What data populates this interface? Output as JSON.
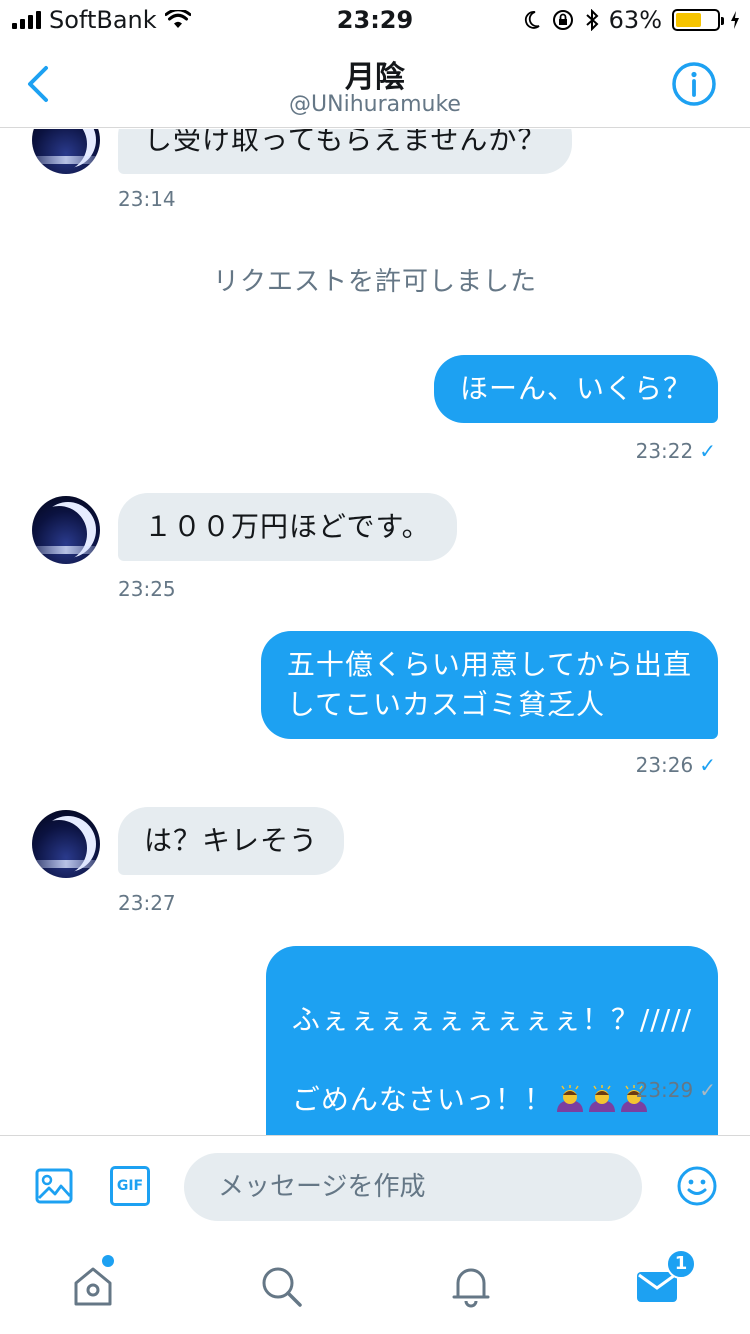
{
  "status_bar": {
    "carrier": "SoftBank",
    "time": "23:29",
    "battery_percent": "63%",
    "battery_level": 0.63,
    "battery_color": "#f6c400",
    "icons": [
      "signal-icon",
      "wifi-icon",
      "moon-icon",
      "rotation-lock-icon",
      "bluetooth-icon",
      "battery-icon",
      "charging-icon"
    ]
  },
  "header": {
    "title": "月陰",
    "handle": "@UNihuramuke",
    "icons": [
      "back-chevron-icon",
      "info-icon"
    ]
  },
  "colors": {
    "accent": "#1da1f2",
    "incoming_bubble": "#e6ecf0",
    "muted_text": "#657786"
  },
  "chat": {
    "messages": [
      {
        "kind": "incoming",
        "text": "し受け取ってもらえませんか？",
        "time": "23:14"
      },
      {
        "kind": "system",
        "text": "リクエストを許可しました"
      },
      {
        "kind": "outgoing",
        "text": "ほーん、いくら？",
        "time": "23:22",
        "read": true
      },
      {
        "kind": "incoming",
        "text": "１００万円ほどです。",
        "time": "23:25"
      },
      {
        "kind": "outgoing",
        "text": "五十億くらい用意してから出直\nしてこいカスゴミ貧乏人",
        "time": "23:26",
        "read": true
      },
      {
        "kind": "incoming",
        "text": "は？キレそう",
        "time": "23:27"
      },
      {
        "kind": "outgoing",
        "line1": "ふぇぇぇぇぇぇぇぇぇ！？/////",
        "line2": "ごめんなさいっ！！",
        "emoji": [
          "bowing-woman-emoji",
          "bowing-woman-emoji",
          "bowing-woman-emoji"
        ],
        "time": "23:29",
        "read": false
      }
    ]
  },
  "composer": {
    "placeholder": "メッセージを作成",
    "gif_label": "GIF",
    "icons": [
      "image-icon",
      "gif-icon",
      "emoji-icon"
    ]
  },
  "tabbar": {
    "tabs": [
      "home",
      "search",
      "notifications",
      "messages"
    ],
    "messages_badge": "1",
    "home_has_dot": true
  }
}
